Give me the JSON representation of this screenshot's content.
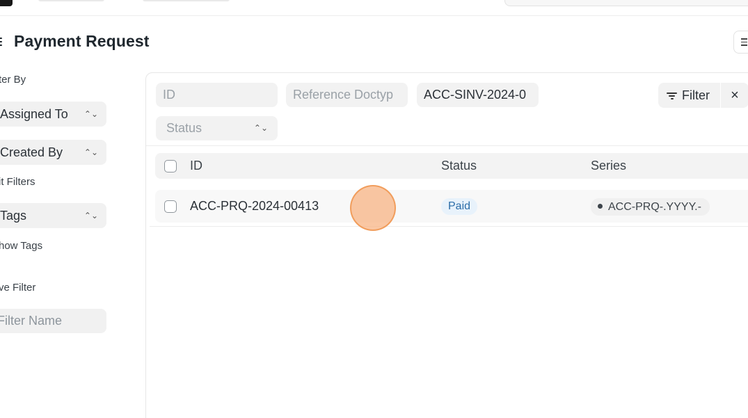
{
  "page": {
    "title": "Payment Request"
  },
  "sidebar": {
    "filter_by_label": "ter By",
    "assigned_to": "Assigned To",
    "created_by": "Created By",
    "edit_filters": "it Filters",
    "tags": "Tags",
    "show_tags": "how Tags",
    "save_filter_label": "ve Filter",
    "filter_name_placeholder": "Filter Name"
  },
  "filters": {
    "id_placeholder": "ID",
    "reference_doctype_placeholder": "Reference Doctyp",
    "reference_name_value": "ACC-SINV-2024-0",
    "status_placeholder": "Status",
    "filter_button": "Filter",
    "clear_icon": "×"
  },
  "table": {
    "columns": [
      "ID",
      "Status",
      "Series"
    ],
    "rows": [
      {
        "id": "ACC-PRQ-2024-00413",
        "status": "Paid",
        "series": "ACC-PRQ-.YYYY.-"
      }
    ]
  },
  "icons": {
    "chevron": "⌃⌄",
    "accent_status_color": "#2c6da8",
    "cursor_color": "#f8b280"
  }
}
